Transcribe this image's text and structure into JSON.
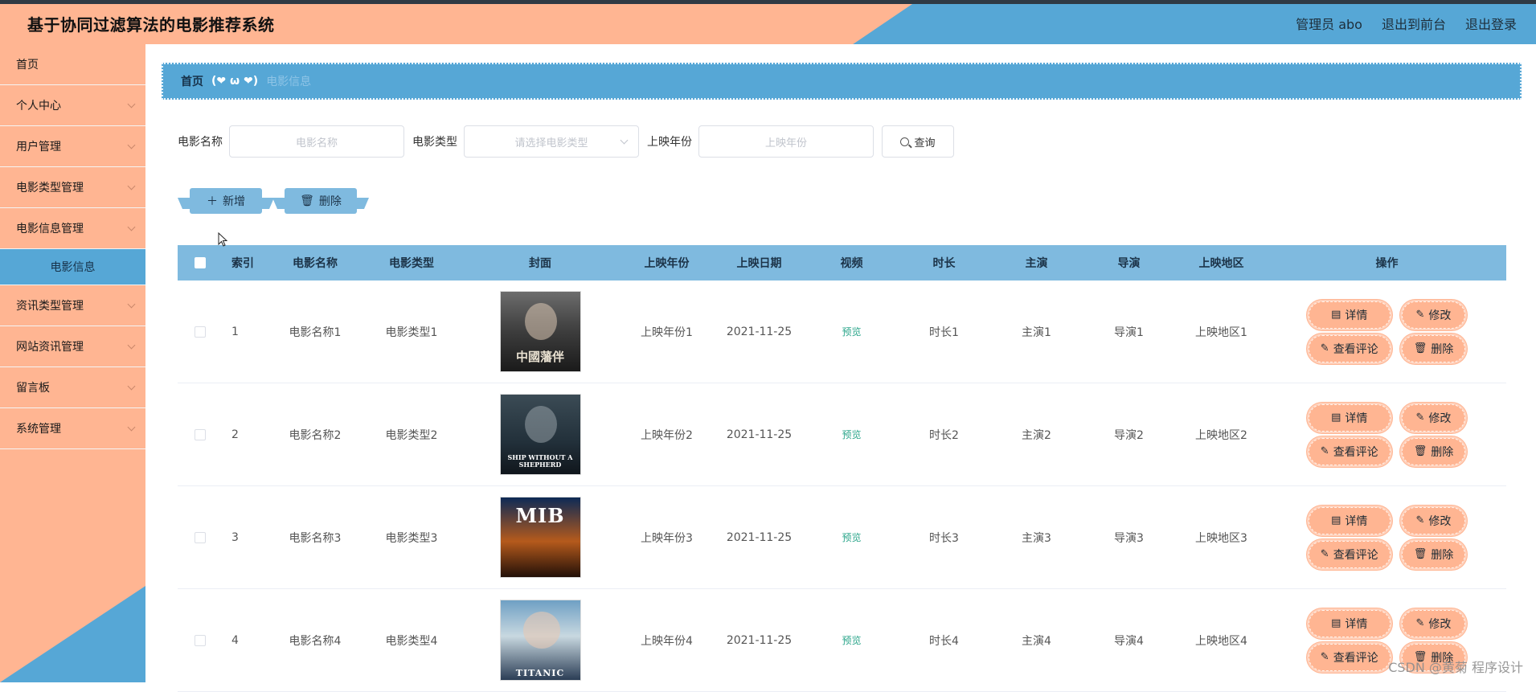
{
  "header": {
    "title": "基于协同过滤算法的电影推荐系统",
    "user": "管理员 abo",
    "to_front": "退出到前台",
    "logout": "退出登录"
  },
  "sidebar": {
    "items": [
      {
        "label": "首页"
      },
      {
        "label": "个人中心"
      },
      {
        "label": "用户管理"
      },
      {
        "label": "电影类型管理"
      },
      {
        "label": "电影信息管理"
      },
      {
        "label": "电影信息",
        "sub": true
      },
      {
        "label": "资讯类型管理"
      },
      {
        "label": "网站资讯管理"
      },
      {
        "label": "留言板"
      },
      {
        "label": "系统管理"
      }
    ]
  },
  "breadcrumb": {
    "home": "首页",
    "separator": "(❤ ω ❤)",
    "current": "电影信息"
  },
  "search": {
    "name_label": "电影名称",
    "name_placeholder": "电影名称",
    "type_label": "电影类型",
    "type_placeholder": "请选择电影类型",
    "year_label": "上映年份",
    "year_placeholder": "上映年份",
    "query_label": "查询"
  },
  "actions": {
    "add_label": "新增",
    "delete_label": "删除"
  },
  "table": {
    "headers": {
      "index": "索引",
      "name": "电影名称",
      "type": "电影类型",
      "cover": "封面",
      "year": "上映年份",
      "date": "上映日期",
      "video": "视频",
      "duration": "时长",
      "actor": "主演",
      "director": "导演",
      "region": "上映地区",
      "ops": "操作"
    },
    "rows": [
      {
        "index": "1",
        "name": "电影名称1",
        "type": "电影类型1",
        "cover_text": "中國藩伴",
        "year": "上映年份1",
        "date": "2021-11-25",
        "video": "预览",
        "duration": "时长1",
        "actor": "主演1",
        "director": "导演1",
        "region": "上映地区1"
      },
      {
        "index": "2",
        "name": "电影名称2",
        "type": "电影类型2",
        "cover_text": "SHIP WITHOUT A SHEPHERD",
        "year": "上映年份2",
        "date": "2021-11-25",
        "video": "预览",
        "duration": "时长2",
        "actor": "主演2",
        "director": "导演2",
        "region": "上映地区2"
      },
      {
        "index": "3",
        "name": "电影名称3",
        "type": "电影类型3",
        "cover_text": "MIB",
        "year": "上映年份3",
        "date": "2021-11-25",
        "video": "预览",
        "duration": "时长3",
        "actor": "主演3",
        "director": "导演3",
        "region": "上映地区3"
      },
      {
        "index": "4",
        "name": "电影名称4",
        "type": "电影类型4",
        "cover_text": "TITANIC",
        "year": "上映年份4",
        "date": "2021-11-25",
        "video": "预览",
        "duration": "时长4",
        "actor": "主演4",
        "director": "导演4",
        "region": "上映地区4"
      }
    ],
    "ops": {
      "detail": "详情",
      "edit": "修改",
      "comments": "查看评论",
      "delete": "删除"
    }
  },
  "watermark": "CSDN @黄菊 程序设计",
  "colors": {
    "peach": "#ffb592",
    "blue": "#56a7d6",
    "light_blue": "#7fbadf",
    "link_green": "#2aa58a"
  }
}
